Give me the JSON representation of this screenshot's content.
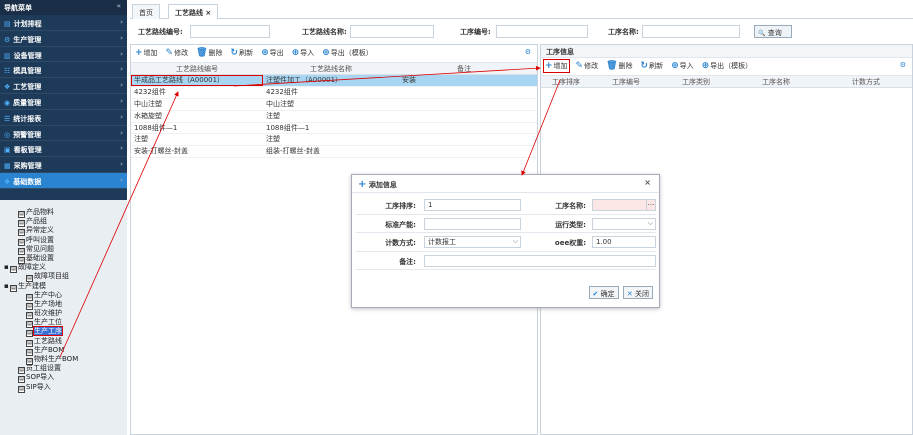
{
  "sidebar": {
    "title": "导航菜单",
    "collapse_glyph": "«",
    "menu": [
      {
        "label": "计划排程",
        "icon": "calendar-icon",
        "glyph": "▤"
      },
      {
        "label": "生产管理",
        "icon": "gear-icon",
        "glyph": "⚙"
      },
      {
        "label": "设备管理",
        "icon": "equipment-icon",
        "glyph": "▥"
      },
      {
        "label": "模具管理",
        "icon": "mold-icon",
        "glyph": "☷"
      },
      {
        "label": "工艺管理",
        "icon": "process-icon",
        "glyph": "❖"
      },
      {
        "label": "质量管理",
        "icon": "quality-icon",
        "glyph": "◉"
      },
      {
        "label": "统计报表",
        "icon": "chart-icon",
        "glyph": "☰"
      },
      {
        "label": "预警管理",
        "icon": "warning-icon",
        "glyph": "◎"
      },
      {
        "label": "看板管理",
        "icon": "board-icon",
        "glyph": "▣"
      },
      {
        "label": "采购管理",
        "icon": "cart-icon",
        "glyph": "▦"
      },
      {
        "label": "基础数据",
        "icon": "data-icon",
        "glyph": "❖"
      }
    ],
    "tree": [
      {
        "label": "产品物料",
        "level": 1,
        "pm": ""
      },
      {
        "label": "产品组",
        "level": 1,
        "pm": ""
      },
      {
        "label": "异常定义",
        "level": 1,
        "pm": ""
      },
      {
        "label": "呼叫设置",
        "level": 1,
        "pm": ""
      },
      {
        "label": "常见问题",
        "level": 1,
        "pm": ""
      },
      {
        "label": "基础设置",
        "level": 1,
        "pm": ""
      },
      {
        "label": "故障定义",
        "level": 0,
        "pm": "▪"
      },
      {
        "label": "故障项目组",
        "level": 2,
        "pm": ""
      },
      {
        "label": "生产建模",
        "level": 0,
        "pm": "▪"
      },
      {
        "label": "生产中心",
        "level": 2,
        "pm": ""
      },
      {
        "label": "生产场地",
        "level": 2,
        "pm": ""
      },
      {
        "label": "班次维护",
        "level": 2,
        "pm": ""
      },
      {
        "label": "生产工位",
        "level": 2,
        "pm": ""
      },
      {
        "label": "生产工序",
        "level": 2,
        "pm": ""
      },
      {
        "label": "工艺路线",
        "level": 2,
        "pm": ""
      },
      {
        "label": "生产BOM",
        "level": 2,
        "pm": ""
      },
      {
        "label": "物料生产BOM",
        "level": 2,
        "pm": ""
      },
      {
        "label": "员工组设置",
        "level": 1,
        "pm": ""
      },
      {
        "label": "SOP导入",
        "level": 1,
        "pm": ""
      },
      {
        "label": "SIP导入",
        "level": 1,
        "pm": ""
      }
    ]
  },
  "tabs": [
    {
      "label": "首页"
    },
    {
      "label": "工艺路线 ×"
    }
  ],
  "filter": {
    "route_code_label": "工艺路线编号:",
    "route_name_label": "工艺路线名称:",
    "process_code_label": "工序编号:",
    "process_name_label": "工序名称:",
    "search_label": "查询",
    "search_glyph": "🔍"
  },
  "left_panel": {
    "toolbar": [
      {
        "label": "增加",
        "glyph": "+",
        "icon": "add-icon"
      },
      {
        "label": "修改",
        "glyph": "✎",
        "icon": "edit-icon"
      },
      {
        "label": "删除",
        "glyph": "🗑",
        "icon": "delete-icon"
      },
      {
        "label": "刷新",
        "glyph": "↻",
        "icon": "refresh-icon"
      },
      {
        "label": "导出",
        "glyph": "⊕",
        "icon": "export-icon"
      },
      {
        "label": "导入",
        "glyph": "⊕",
        "icon": "import-icon"
      },
      {
        "label": "导出（模板）",
        "glyph": "⊕",
        "icon": "export-template-icon"
      }
    ],
    "gear_glyph": "⚙",
    "columns": [
      "工艺路线编号",
      "工艺路线名称",
      "备注"
    ],
    "rows": [
      [
        "半成品工艺路线（A00001）",
        "注塑件加工（A00001）",
        "安装"
      ],
      [
        "4232组件",
        "4232组件",
        ""
      ],
      [
        "中山注塑",
        "中山注塑",
        ""
      ],
      [
        "水箱旋塑",
        "注塑",
        ""
      ],
      [
        "1088组件—1",
        "1088组件—1",
        ""
      ],
      [
        "注塑",
        "注塑",
        ""
      ],
      [
        "安装-打螺丝-封盖",
        "组装-打螺丝-封盖",
        ""
      ]
    ]
  },
  "right_panel": {
    "title": "工序信息",
    "toolbar": [
      {
        "label": "增加",
        "glyph": "+",
        "icon": "add-icon"
      },
      {
        "label": "修改",
        "glyph": "✎",
        "icon": "edit-icon"
      },
      {
        "label": "删除",
        "glyph": "🗑",
        "icon": "delete-icon"
      },
      {
        "label": "刷新",
        "glyph": "↻",
        "icon": "refresh-icon"
      },
      {
        "label": "导入",
        "glyph": "⊕",
        "icon": "import-icon"
      },
      {
        "label": "导出（模板）",
        "glyph": "⊕",
        "icon": "export-template-icon"
      }
    ],
    "gear_glyph": "⚙",
    "columns": [
      "工序排序",
      "工序编号",
      "工序类别",
      "工序名称",
      "计数方式"
    ]
  },
  "modal": {
    "title": "添加信息",
    "plus_glyph": "+",
    "close_glyph": "×",
    "fields": {
      "order_label": "工序排序:",
      "order_value": "1",
      "name_label": "工序名称:",
      "name_value": "",
      "capacity_label": "标准产能:",
      "capacity_value": "",
      "run_type_label": "运行类型:",
      "run_type_value": "",
      "count_label": "计数方式:",
      "count_value": "计数报工",
      "oee_label": "oee权重:",
      "oee_value": "1.00",
      "remark_label": "备注:",
      "remark_value": ""
    },
    "ellipsis": "...",
    "chevron": "⌵",
    "confirm_label": "确定",
    "confirm_glyph": "✔",
    "cancel_label": "关闭",
    "cancel_glyph": "✕"
  },
  "colors": {
    "sidebar_bg": "#1d3a59",
    "active_blue": "#2a84d0",
    "selection_row": "#a8d6f2",
    "annotation_red": "#dd0000"
  }
}
